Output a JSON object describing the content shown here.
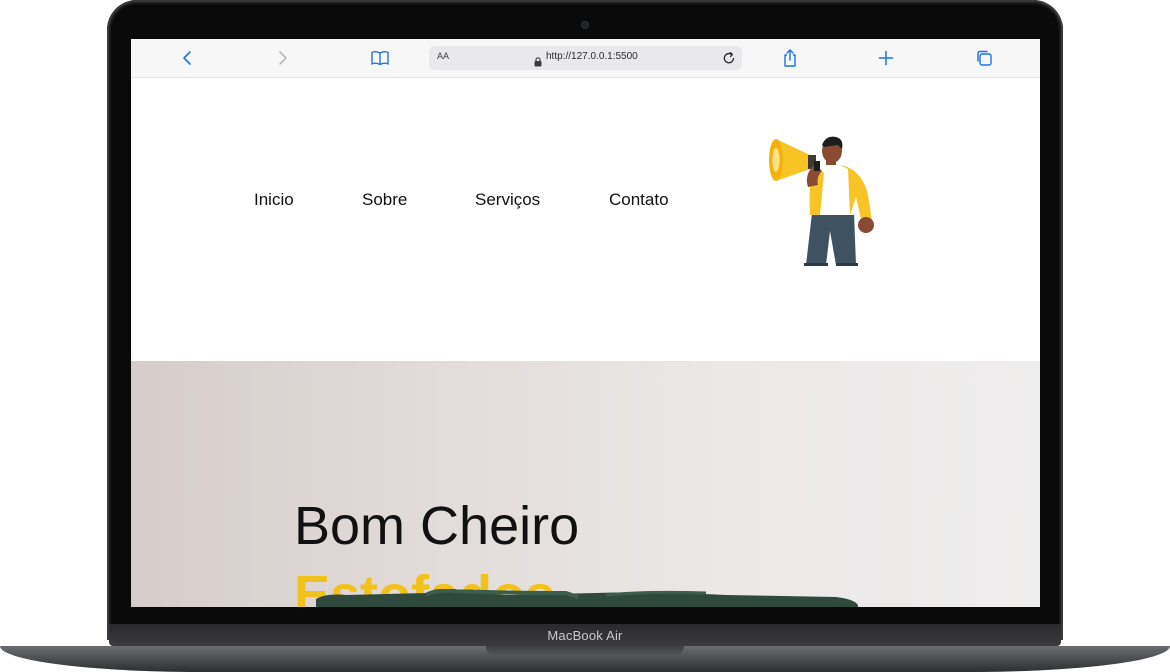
{
  "device": {
    "brand_label": "MacBook Air"
  },
  "browser": {
    "text_size_label": "AA",
    "url": "http://127.0.0.1:5500",
    "icons": [
      "chevron-left-icon",
      "chevron-right-icon",
      "book-icon",
      "lock-icon",
      "reload-icon",
      "share-icon",
      "plus-icon",
      "tabs-icon"
    ],
    "accent_color": "#1a73e8"
  },
  "site": {
    "nav": {
      "items": [
        {
          "label": "Inicio"
        },
        {
          "label": "Sobre"
        },
        {
          "label": "Serviços"
        },
        {
          "label": "Contato"
        }
      ]
    },
    "hero": {
      "title": "Bom Cheiro",
      "subtitle": "Estofados",
      "title_color": "#111111",
      "subtitle_color": "#f2c21b"
    },
    "illustration": "person-with-megaphone"
  }
}
